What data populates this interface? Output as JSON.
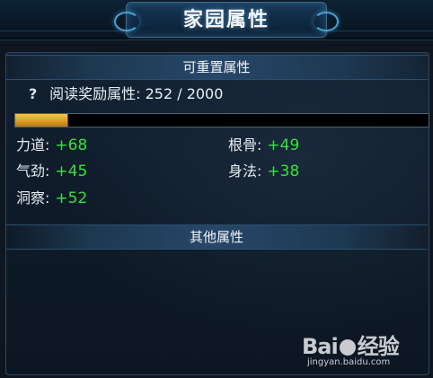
{
  "header": {
    "title": "家园属性"
  },
  "resettable_section": {
    "title": "可重置属性",
    "reading_label": "阅读奖励属性:",
    "reading_value": "252 / 2000",
    "progress": {
      "current": 252,
      "max": 2000
    }
  },
  "attributes": [
    {
      "label": "力道:",
      "value": "+68"
    },
    {
      "label": "根骨:",
      "value": "+49"
    },
    {
      "label": "气劲:",
      "value": "+45"
    },
    {
      "label": "身法:",
      "value": "+38"
    },
    {
      "label": "洞察:",
      "value": "+52"
    }
  ],
  "other_section": {
    "title": "其他属性"
  },
  "watermark": {
    "main": "Bai",
    "suffix": "经验",
    "url": "jingyan.baidu.com"
  },
  "colors": {
    "value_green": "#38e23c",
    "progress_orange": "#d99a22",
    "panel_bg": "#0f1b29"
  },
  "icons": {
    "help": "question-mark",
    "watermark_logo": "paw-icon"
  }
}
